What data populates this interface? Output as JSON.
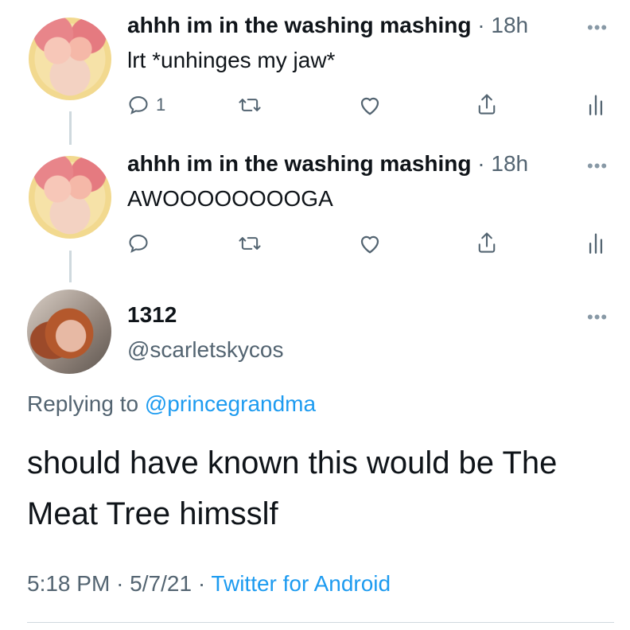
{
  "tweets": [
    {
      "name": "ahhh im in the washing mashing",
      "separator": "·",
      "time": "18h",
      "text": "lrt *unhinges my jaw*",
      "reply_count": "1",
      "more": "•••"
    },
    {
      "name": "ahhh im in the washing mashing",
      "separator": "·",
      "time": "18h",
      "text": "AWOOOOOOOOGA",
      "reply_count": "",
      "more": "•••"
    }
  ],
  "main": {
    "name": "1312",
    "handle": "@scarletskycos",
    "more": "•••",
    "replying_prefix": "Replying to",
    "replying_handle": "@princegrandma",
    "text": "should have known this would be The Meat Tree himsslf",
    "time": "5:18 PM",
    "date": "5/7/21",
    "source": "Twitter for Android",
    "separator": "·"
  },
  "colors": {
    "link": "#1d9bf0",
    "secondary": "#536471",
    "primary": "#0f1419",
    "thread_line": "#cfd9de"
  },
  "icons": [
    "reply-icon",
    "retweet-icon",
    "like-icon",
    "share-icon",
    "analytics-icon",
    "more-icon"
  ]
}
